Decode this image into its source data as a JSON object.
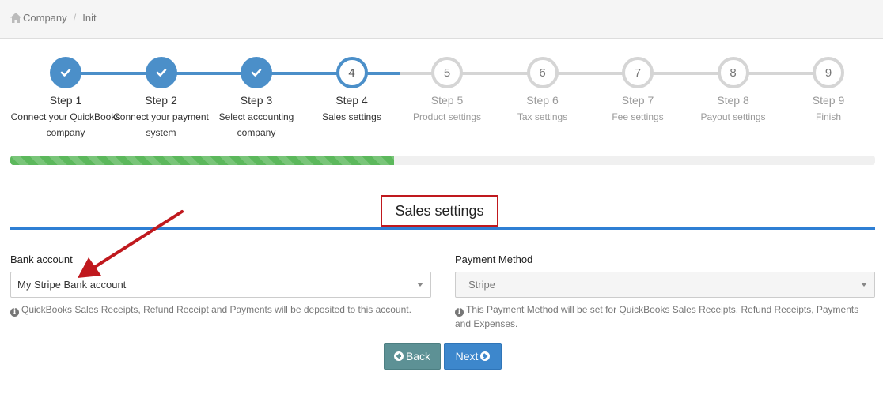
{
  "breadcrumb": {
    "items": [
      "Company",
      "Init"
    ],
    "separator": "/"
  },
  "wizard": {
    "progress_percent": 44.4,
    "steps": [
      {
        "number": "1",
        "title": "Step 1",
        "desc1": "Connect your QuickBooks",
        "desc2": "company",
        "state": "done"
      },
      {
        "number": "2",
        "title": "Step 2",
        "desc1": "Connect your payment",
        "desc2": "system",
        "state": "done"
      },
      {
        "number": "3",
        "title": "Step 3",
        "desc1": "Select accounting",
        "desc2": "company",
        "state": "done"
      },
      {
        "number": "4",
        "title": "Step 4",
        "desc1": "Sales settings",
        "desc2": "",
        "state": "active"
      },
      {
        "number": "5",
        "title": "Step 5",
        "desc1": "Product settings",
        "desc2": "",
        "state": "todo"
      },
      {
        "number": "6",
        "title": "Step 6",
        "desc1": "Tax settings",
        "desc2": "",
        "state": "todo"
      },
      {
        "number": "7",
        "title": "Step 7",
        "desc1": "Fee settings",
        "desc2": "",
        "state": "todo"
      },
      {
        "number": "8",
        "title": "Step 8",
        "desc1": "Payout settings",
        "desc2": "",
        "state": "todo"
      },
      {
        "number": "9",
        "title": "Step 9",
        "desc1": "Finish",
        "desc2": "",
        "state": "todo"
      }
    ]
  },
  "section": {
    "title": "Sales settings"
  },
  "bank_account": {
    "label": "Bank account",
    "selected": "My Stripe Bank account",
    "help": "QuickBooks Sales Receipts, Refund Receipt and Payments will be deposited to this account."
  },
  "payment_method": {
    "label": "Payment Method",
    "selected": "Stripe",
    "help": "This Payment Method will be set for QuickBooks Sales Receipts, Refund Receipts, Payments and Expenses."
  },
  "buttons": {
    "back": "Back",
    "next": "Next"
  },
  "colors": {
    "primary": "#4b8fc9",
    "progress": "#5cb85c",
    "highlight": "#c0191e",
    "rule": "#2f7fd4",
    "back_button": "#5d9195"
  },
  "icons": {
    "home": "home-icon",
    "check": "check-icon",
    "info": "info-icon",
    "back": "arrow-circle-left-icon",
    "next": "arrow-circle-right-icon"
  }
}
